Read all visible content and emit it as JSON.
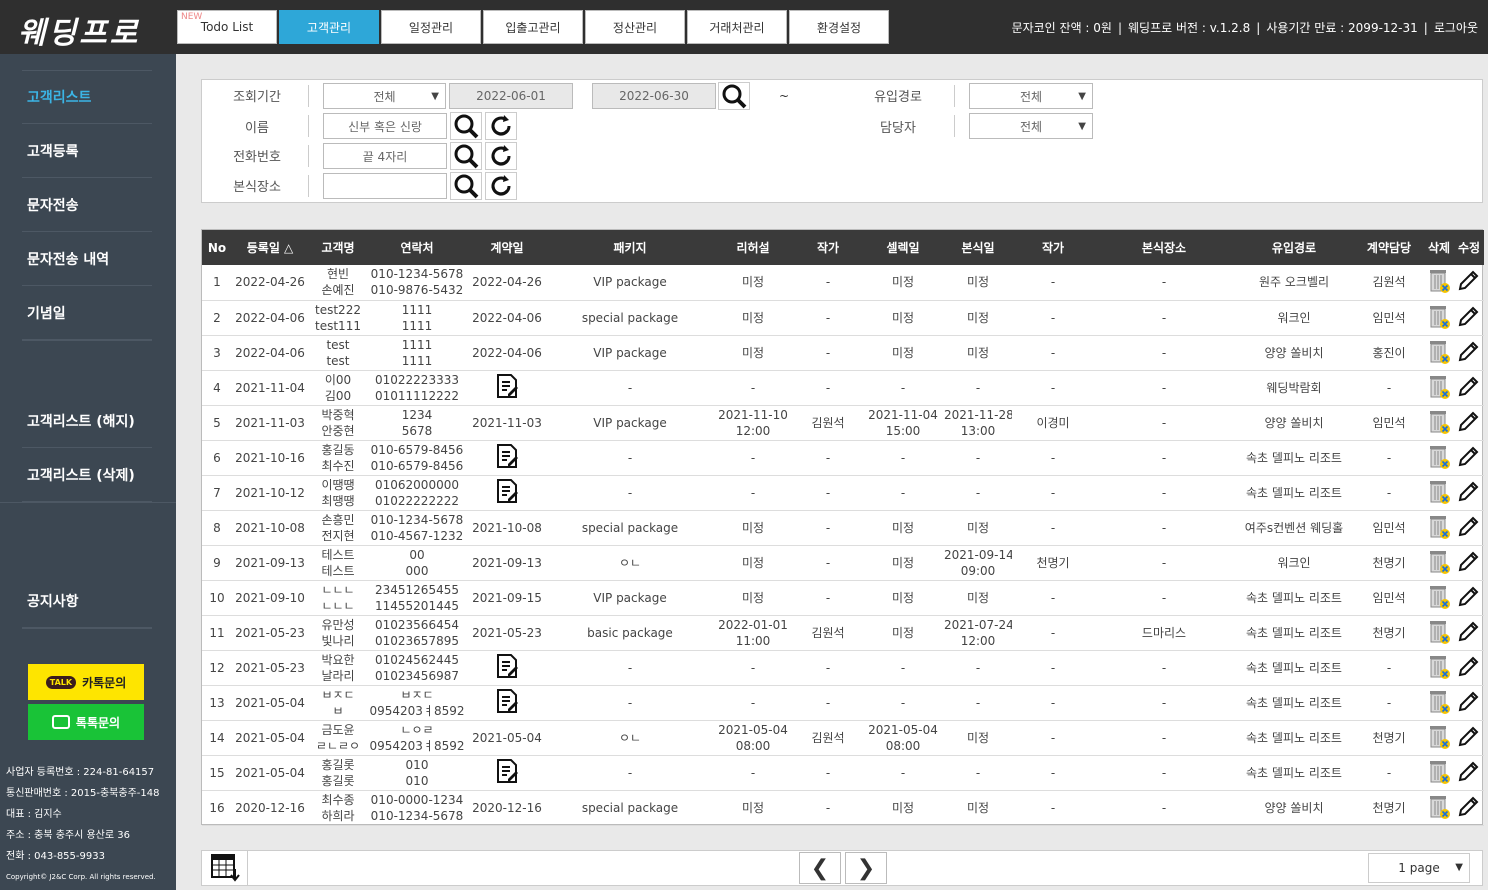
{
  "header": {
    "logo": "웨딩프로",
    "new_badge": "NEW",
    "tabs": [
      "Todo List",
      "고객관리",
      "일정관리",
      "입출고관리",
      "정산관리",
      "거래처관리",
      "환경설정"
    ],
    "active_tab": 1,
    "sms_balance": "문자코인 잔액 : 0원",
    "version": "웨딩프로 버전 : v.1.2.8",
    "expiry": "사용기간 만료 : 2099-12-31",
    "logout": "로그아웃"
  },
  "sidebar": {
    "items": [
      "고객리스트",
      "고객등록",
      "문자전송",
      "문자전송 내역",
      "기념일",
      "고객리스트 (해지)",
      "고객리스트 (삭제)",
      "공지사항"
    ],
    "kakao": "카톡문의",
    "kakao_icon": "TALK",
    "talk": "톡톡문의",
    "company": [
      "사업자 등록번호 : 224-81-64157",
      "통신판매번호 : 2015-충북충주-148",
      "대표 : 김지수",
      "주소 : 충북 충주시 용산로 36",
      "전화 : 043-855-9933",
      "Copyright© J2&C Corp. All rights reserved."
    ]
  },
  "filter": {
    "labels": {
      "period": "조회기간",
      "name": "이름",
      "phone": "전화번호",
      "venue": "본식장소",
      "source": "유입경로",
      "manager": "담당자"
    },
    "period_select": "전체",
    "date_from": "2022-06-01",
    "date_to": "2022-06-30",
    "tilde": "~",
    "name_placeholder": "신부 혹은 신랑",
    "phone_placeholder": "끝 4자리",
    "venue_value": "",
    "source_select": "전체",
    "manager_select": "전체"
  },
  "table": {
    "columns": [
      "No",
      "등록일 △",
      "고객명",
      "연락처",
      "계약일",
      "패키지",
      "리허설",
      "작가",
      "셀렉일",
      "본식일",
      "작가",
      "본식장소",
      "유입경로",
      "계약담당",
      "삭제",
      "수정"
    ],
    "rows": [
      {
        "no": "1",
        "reg": "2022-04-26",
        "name": [
          "현빈",
          "손예진"
        ],
        "phone": [
          "010-1234-5678",
          "010-9876-5432"
        ],
        "contract": "2022-04-26",
        "pkg": "VIP package",
        "rehearsal": [
          "미정"
        ],
        "photo1": "-",
        "select": [
          "미정"
        ],
        "wedding": [
          "미정"
        ],
        "photo2": "-",
        "venue": "-",
        "source": "원주 오크벨리",
        "manager": "김원석"
      },
      {
        "no": "2",
        "reg": "2022-04-06",
        "name": [
          "test222",
          "test111"
        ],
        "phone": [
          "1111",
          "1111"
        ],
        "contract": "2022-04-06",
        "pkg": "special package",
        "rehearsal": [
          "미정"
        ],
        "photo1": "-",
        "select": [
          "미정"
        ],
        "wedding": [
          "미정"
        ],
        "photo2": "-",
        "venue": "-",
        "source": "워크인",
        "manager": "임민석"
      },
      {
        "no": "3",
        "reg": "2022-04-06",
        "name": [
          "test",
          "test"
        ],
        "phone": [
          "1111",
          "1111"
        ],
        "contract": "2022-04-06",
        "pkg": "VIP package",
        "rehearsal": [
          "미정"
        ],
        "photo1": "-",
        "select": [
          "미정"
        ],
        "wedding": [
          "미정"
        ],
        "photo2": "-",
        "venue": "-",
        "source": "양양 쏠비치",
        "manager": "홍진이"
      },
      {
        "no": "4",
        "reg": "2021-11-04",
        "name": [
          "이00",
          "김00"
        ],
        "phone": [
          "01022223333",
          "01011112222"
        ],
        "contract": "",
        "pkg": "-",
        "rehearsal": [
          "-"
        ],
        "photo1": "-",
        "select": [
          "-"
        ],
        "wedding": [
          "-"
        ],
        "photo2": "-",
        "venue": "-",
        "source": "웨딩박람회",
        "manager": "-"
      },
      {
        "no": "5",
        "reg": "2021-11-03",
        "name": [
          "박중혁",
          "안중현"
        ],
        "phone": [
          "1234",
          "5678"
        ],
        "contract": "2021-11-03",
        "pkg": "VIP package",
        "rehearsal": [
          "2021-11-10",
          "12:00"
        ],
        "photo1": "김원석",
        "select": [
          "2021-11-04",
          "15:00"
        ],
        "wedding": [
          "2021-11-28",
          "13:00"
        ],
        "photo2": "이경미",
        "venue": "-",
        "source": "양양 쏠비치",
        "manager": "임민석"
      },
      {
        "no": "6",
        "reg": "2021-10-16",
        "name": [
          "홍길동",
          "최수진"
        ],
        "phone": [
          "010-6579-8456",
          "010-6579-8456"
        ],
        "contract": "",
        "pkg": "-",
        "rehearsal": [
          "-"
        ],
        "photo1": "-",
        "select": [
          "-"
        ],
        "wedding": [
          "-"
        ],
        "photo2": "-",
        "venue": "-",
        "source": "속초 델피노 리조트",
        "manager": "-"
      },
      {
        "no": "7",
        "reg": "2021-10-12",
        "name": [
          "이땡땡",
          "최땡땡"
        ],
        "phone": [
          "01062000000",
          "01022222222"
        ],
        "contract": "",
        "pkg": "-",
        "rehearsal": [
          "-"
        ],
        "photo1": "-",
        "select": [
          "-"
        ],
        "wedding": [
          "-"
        ],
        "photo2": "-",
        "venue": "-",
        "source": "속초 델피노 리조트",
        "manager": "-"
      },
      {
        "no": "8",
        "reg": "2021-10-08",
        "name": [
          "손흥민",
          "전지현"
        ],
        "phone": [
          "010-1234-5678",
          "010-4567-1232"
        ],
        "contract": "2021-10-08",
        "pkg": "special package",
        "rehearsal": [
          "미정"
        ],
        "photo1": "-",
        "select": [
          "미정"
        ],
        "wedding": [
          "미정"
        ],
        "photo2": "-",
        "venue": "-",
        "source": "여주s컨벤션 웨딩홀",
        "manager": "임민석"
      },
      {
        "no": "9",
        "reg": "2021-09-13",
        "name": [
          "테스트",
          "테스트"
        ],
        "phone": [
          "00",
          "000"
        ],
        "contract": "2021-09-13",
        "pkg": "ㅇㄴ",
        "rehearsal": [
          "미정"
        ],
        "photo1": "-",
        "select": [
          "미정"
        ],
        "wedding": [
          "2021-09-14",
          "09:00"
        ],
        "photo2": "천명기",
        "venue": "-",
        "source": "워크인",
        "manager": "천명기"
      },
      {
        "no": "10",
        "reg": "2021-09-10",
        "name": [
          "ㄴㄴㄴ",
          "ㄴㄴㄴ"
        ],
        "phone": [
          "23451265455",
          "11455201445"
        ],
        "contract": "2021-09-15",
        "pkg": "VIP package",
        "rehearsal": [
          "미정"
        ],
        "photo1": "-",
        "select": [
          "미정"
        ],
        "wedding": [
          "미정"
        ],
        "photo2": "-",
        "venue": "-",
        "source": "속초 델피노 리조트",
        "manager": "임민석"
      },
      {
        "no": "11",
        "reg": "2021-05-23",
        "name": [
          "유만성",
          "빛나리"
        ],
        "phone": [
          "01023566454",
          "01023657895"
        ],
        "contract": "2021-05-23",
        "pkg": "basic package",
        "rehearsal": [
          "2022-01-01",
          "11:00"
        ],
        "photo1": "김원석",
        "select": [
          "미정"
        ],
        "wedding": [
          "2021-07-24",
          "12:00"
        ],
        "photo2": "-",
        "venue": "드마리스",
        "source": "속초 델피노 리조트",
        "manager": "천명기"
      },
      {
        "no": "12",
        "reg": "2021-05-23",
        "name": [
          "박요한",
          "날라리"
        ],
        "phone": [
          "01024562445",
          "01023456987"
        ],
        "contract": "",
        "pkg": "-",
        "rehearsal": [
          "-"
        ],
        "photo1": "-",
        "select": [
          "-"
        ],
        "wedding": [
          "-"
        ],
        "photo2": "-",
        "venue": "-",
        "source": "속초 델피노 리조트",
        "manager": "-"
      },
      {
        "no": "13",
        "reg": "2021-05-04",
        "name": [
          "ㅂㅈㄷ",
          "ㅂ"
        ],
        "phone": [
          "ㅂㅈㄷ",
          "0954203ㅕ8592"
        ],
        "contract": "",
        "pkg": "-",
        "rehearsal": [
          "-"
        ],
        "photo1": "-",
        "select": [
          "-"
        ],
        "wedding": [
          "-"
        ],
        "photo2": "-",
        "venue": "-",
        "source": "속초 델피노 리조트",
        "manager": "-"
      },
      {
        "no": "14",
        "reg": "2021-05-04",
        "name": [
          "금도윤",
          "ㄹㄴㄹㅇ"
        ],
        "phone": [
          "ㄴㅇㄹ",
          "0954203ㅕ8592"
        ],
        "contract": "2021-05-04",
        "pkg": "ㅇㄴ",
        "rehearsal": [
          "2021-05-04",
          "08:00"
        ],
        "photo1": "김원석",
        "select": [
          "2021-05-04",
          "08:00"
        ],
        "wedding": [
          "미정"
        ],
        "photo2": "-",
        "venue": "-",
        "source": "속초 델피노 리조트",
        "manager": "천명기"
      },
      {
        "no": "15",
        "reg": "2021-05-04",
        "name": [
          "홍길롯",
          "홍길롯"
        ],
        "phone": [
          "010",
          "010"
        ],
        "contract": "",
        "pkg": "-",
        "rehearsal": [
          "-"
        ],
        "photo1": "-",
        "select": [
          "-"
        ],
        "wedding": [
          "-"
        ],
        "photo2": "-",
        "venue": "-",
        "source": "속초 델피노 리조트",
        "manager": "-"
      },
      {
        "no": "16",
        "reg": "2020-12-16",
        "name": [
          "최수종",
          "하희라"
        ],
        "phone": [
          "010-0000-1234",
          "010-1234-5678"
        ],
        "contract": "2020-12-16",
        "pkg": "special package",
        "rehearsal": [
          "미정"
        ],
        "photo1": "-",
        "select": [
          "미정"
        ],
        "wedding": [
          "미정"
        ],
        "photo2": "-",
        "venue": "-",
        "source": "양양 쏠비치",
        "manager": "천명기"
      }
    ]
  },
  "pagination": {
    "page_select": "1 page",
    "prev_glyph": "❮",
    "next_glyph": "❯"
  },
  "colors": {
    "accent": "#2ea7d8",
    "topbar": "#2f2f2f",
    "sidebar": "#3c4752",
    "kakao": "#fee500",
    "talk": "#19c337"
  }
}
